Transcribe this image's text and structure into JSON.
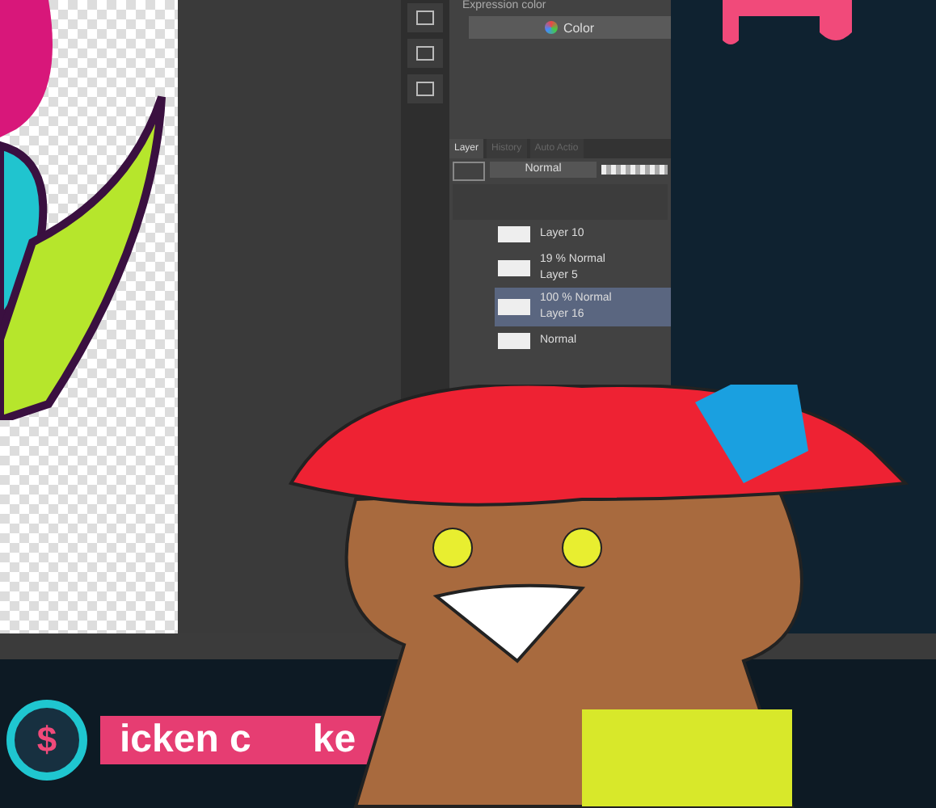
{
  "layer_panel": {
    "expression_color_label": "Expression color",
    "color_button": "Color",
    "tabs": [
      {
        "label": "Layer",
        "selected": true
      },
      {
        "label": "History",
        "selected": false
      },
      {
        "label": "Auto Actio",
        "selected": false
      }
    ],
    "blend_mode": "Normal",
    "layers": [
      {
        "name": "Layer 10",
        "selected": false
      },
      {
        "info": "19 % Normal",
        "name": "Layer 5",
        "selected": false
      },
      {
        "info": "100 % Normal",
        "name": "Layer 16",
        "selected": true
      },
      {
        "info": "Normal",
        "selected": false
      }
    ]
  },
  "banner": {
    "symbol": "$",
    "text_parts": [
      "icken c",
      "ke"
    ]
  }
}
